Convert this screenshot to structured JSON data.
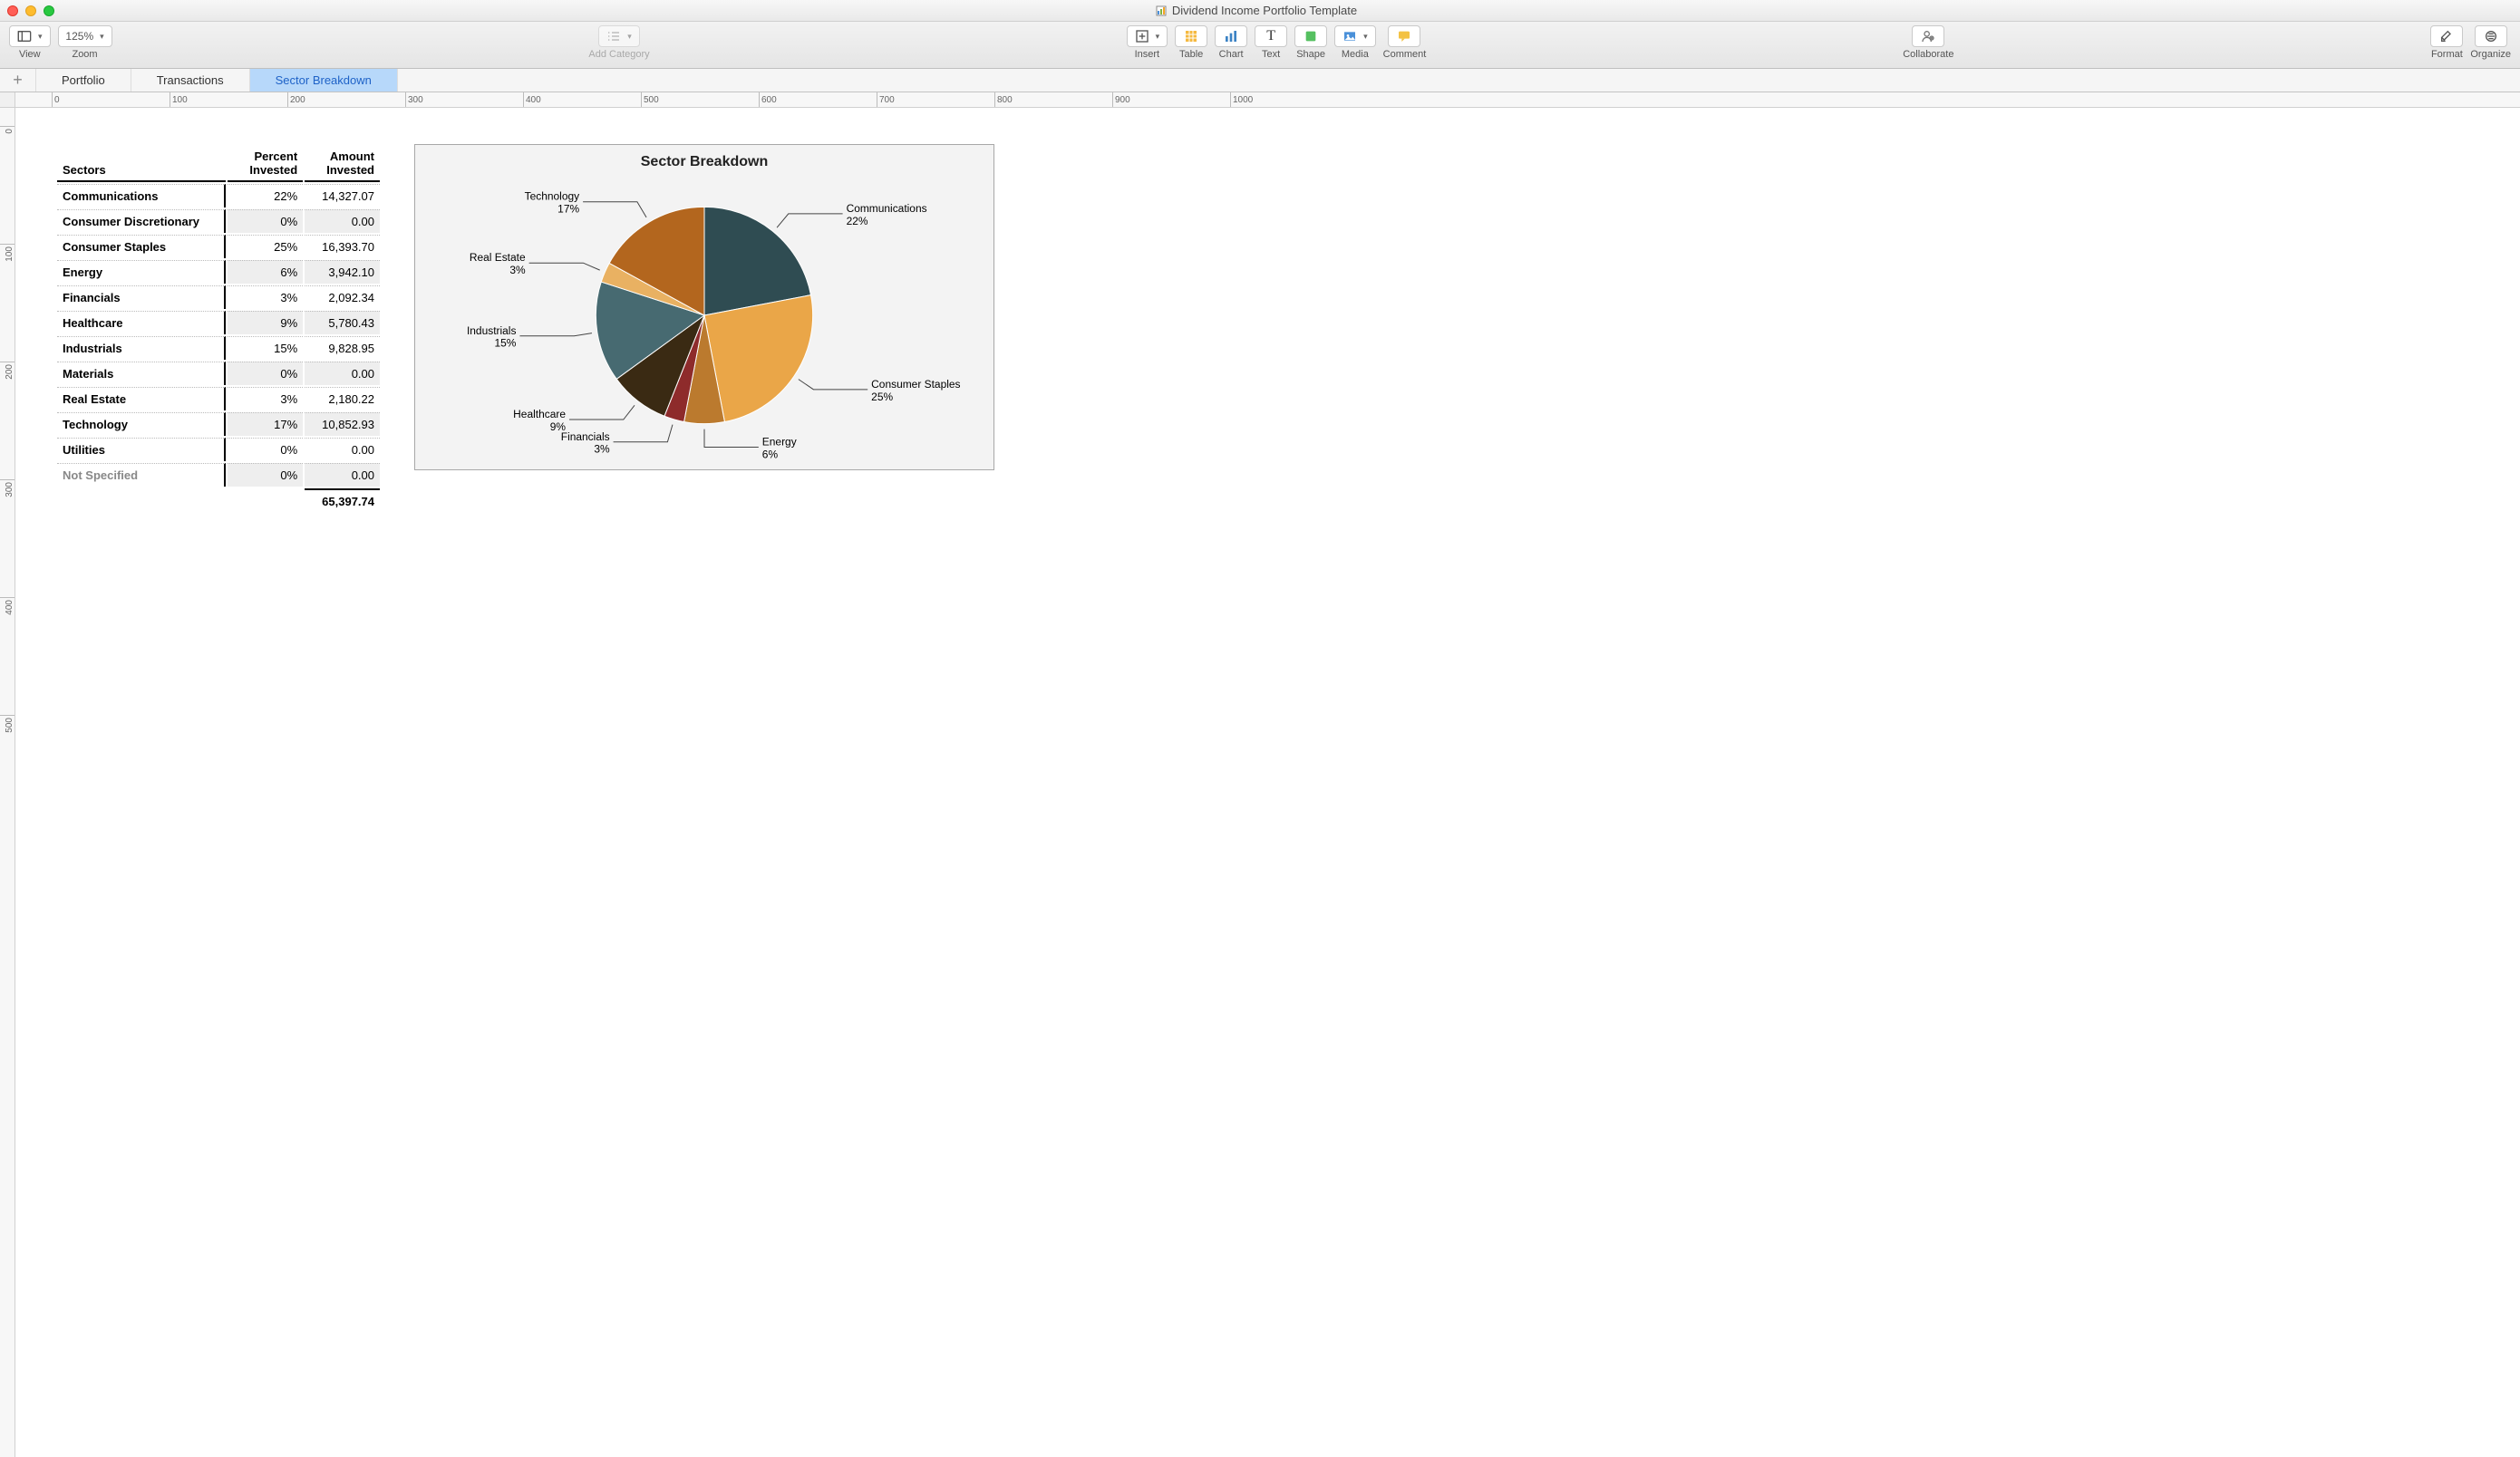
{
  "window": {
    "title": "Dividend Income Portfolio Template"
  },
  "toolbar": {
    "view": "View",
    "zoom": "Zoom",
    "zoom_value": "125%",
    "add_category": "Add Category",
    "insert": "Insert",
    "table": "Table",
    "chart": "Chart",
    "text": "Text",
    "shape": "Shape",
    "media": "Media",
    "comment": "Comment",
    "collaborate": "Collaborate",
    "format": "Format",
    "organize": "Organize"
  },
  "sheets": {
    "portfolio": "Portfolio",
    "transactions": "Transactions",
    "sector_breakdown": "Sector Breakdown"
  },
  "ruler_h": [
    "0",
    "100",
    "200",
    "300",
    "400",
    "500",
    "600",
    "700",
    "800",
    "900",
    "1000"
  ],
  "ruler_v": [
    "0",
    "100",
    "200",
    "300",
    "400",
    "500"
  ],
  "table": {
    "header_sectors": "Sectors",
    "header_percent": "Percent Invested",
    "header_amount": "Amount Invested",
    "rows": [
      {
        "name": "Communications",
        "percent": "22%",
        "amount": "14,327.07"
      },
      {
        "name": "Consumer Discretionary",
        "percent": "0%",
        "amount": "0.00"
      },
      {
        "name": "Consumer Staples",
        "percent": "25%",
        "amount": "16,393.70"
      },
      {
        "name": "Energy",
        "percent": "6%",
        "amount": "3,942.10"
      },
      {
        "name": "Financials",
        "percent": "3%",
        "amount": "2,092.34"
      },
      {
        "name": "Healthcare",
        "percent": "9%",
        "amount": "5,780.43"
      },
      {
        "name": "Industrials",
        "percent": "15%",
        "amount": "9,828.95"
      },
      {
        "name": "Materials",
        "percent": "0%",
        "amount": "0.00"
      },
      {
        "name": "Real Estate",
        "percent": "3%",
        "amount": "2,180.22"
      },
      {
        "name": "Technology",
        "percent": "17%",
        "amount": "10,852.93"
      },
      {
        "name": "Utilities",
        "percent": "0%",
        "amount": "0.00"
      },
      {
        "name": "Not Specified",
        "percent": "0%",
        "amount": "0.00"
      }
    ],
    "total": "65,397.74"
  },
  "chart": {
    "title": "Sector Breakdown"
  },
  "chart_data": {
    "type": "pie",
    "title": "Sector Breakdown",
    "series": [
      {
        "name": "Communications",
        "percent": 22,
        "label": "Communications",
        "sublabel": "22%",
        "color": "#2f4c52"
      },
      {
        "name": "Consumer Staples",
        "percent": 25,
        "label": "Consumer Staples",
        "sublabel": "25%",
        "color": "#eaa648"
      },
      {
        "name": "Energy",
        "percent": 6,
        "label": "Energy",
        "sublabel": "6%",
        "color": "#bb7a2e"
      },
      {
        "name": "Financials",
        "percent": 3,
        "label": "Financials",
        "sublabel": "3%",
        "color": "#8e2b2b"
      },
      {
        "name": "Healthcare",
        "percent": 9,
        "label": "Healthcare",
        "sublabel": "9%",
        "color": "#3a2a13"
      },
      {
        "name": "Industrials",
        "percent": 15,
        "label": "Industrials",
        "sublabel": "15%",
        "color": "#476a71"
      },
      {
        "name": "Real Estate",
        "percent": 3,
        "label": "Real Estate",
        "sublabel": "3%",
        "color": "#e9b162"
      },
      {
        "name": "Technology",
        "percent": 17,
        "label": "Technology",
        "sublabel": "17%",
        "color": "#b3661e"
      }
    ]
  }
}
